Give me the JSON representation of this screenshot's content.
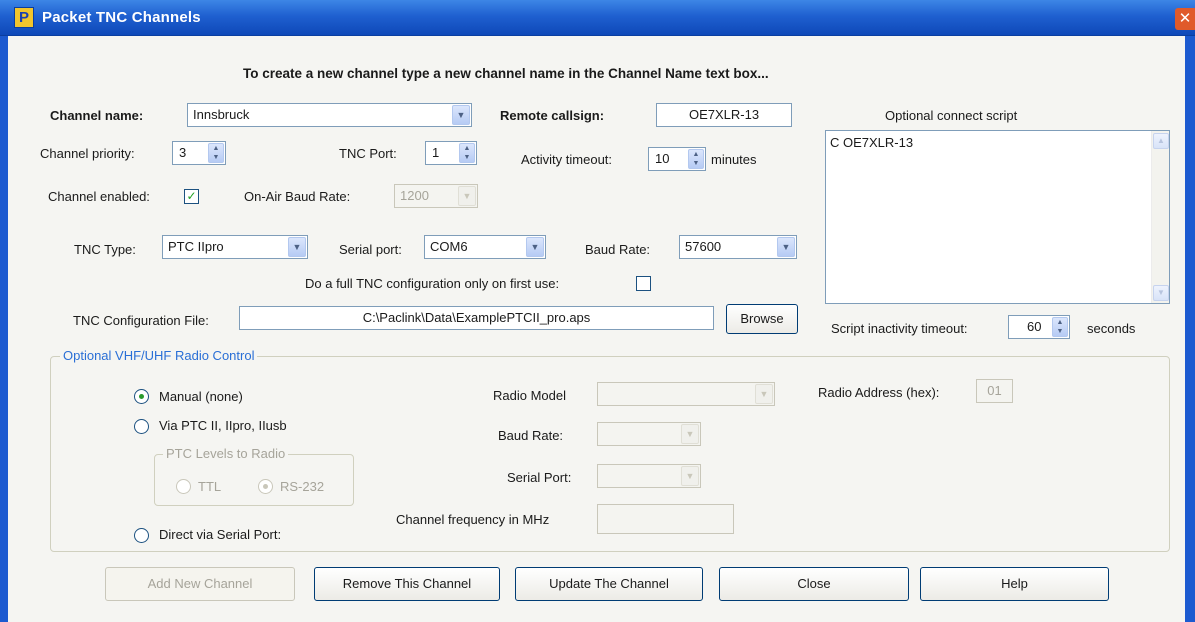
{
  "window": {
    "title": "Packet TNC Channels",
    "app_icon_glyph": "P",
    "close_glyph": "✕"
  },
  "instruction": "To create a new channel type a new channel name in the Channel Name text box...",
  "channel": {
    "name_label": "Channel name:",
    "name_value": "Innsbruck",
    "remote_callsign_label": "Remote callsign:",
    "remote_callsign_value": "OE7XLR-13",
    "priority_label": "Channel priority:",
    "priority_value": "3",
    "tnc_port_label": "TNC Port:",
    "tnc_port_value": "1",
    "activity_timeout_label": "Activity timeout:",
    "activity_timeout_value": "10",
    "activity_timeout_unit": "minutes",
    "enabled_label": "Channel enabled:",
    "enabled_checked": true,
    "onair_baud_label": "On-Air Baud Rate:",
    "onair_baud_value": "1200"
  },
  "tnc": {
    "type_label": "TNC Type:",
    "type_value": "PTC IIpro",
    "serial_port_label": "Serial port:",
    "serial_port_value": "COM6",
    "baud_rate_label": "Baud Rate:",
    "baud_rate_value": "57600",
    "full_config_label": "Do a full TNC configuration only on first use:",
    "full_config_checked": false,
    "config_file_label": "TNC Configuration File:",
    "config_file_value": "C:\\Paclink\\Data\\ExamplePTCII_pro.aps",
    "browse_label": "Browse"
  },
  "script": {
    "label": "Optional connect script",
    "content": "C OE7XLR-13",
    "inactivity_label": "Script inactivity timeout:",
    "inactivity_value": "60",
    "inactivity_unit": "seconds"
  },
  "radio": {
    "group_label": "Optional VHF/UHF Radio Control",
    "manual_label": "Manual (none)",
    "manual_selected": true,
    "via_ptc_label": "Via PTC II, IIpro, IIusb",
    "levels_group_label": "PTC Levels to Radio",
    "ttl_label": "TTL",
    "rs232_label": "RS-232",
    "direct_label": "Direct via Serial Port:",
    "model_label": "Radio Model",
    "model_value": "",
    "address_label": "Radio Address (hex):",
    "address_value": "01",
    "baud_label": "Baud Rate:",
    "baud_value": "",
    "serial_label": "Serial Port:",
    "serial_value": "",
    "frequency_label": "Channel frequency in MHz",
    "frequency_value": ""
  },
  "buttons": {
    "add": "Add New Channel",
    "remove": "Remove This Channel",
    "update": "Update The Channel",
    "close": "Close",
    "help": "Help"
  },
  "icons": {
    "dropdown": "▼",
    "spin_up": "▲",
    "spin_down": "▼",
    "check": "✓"
  },
  "colors": {
    "titlebar": "#1f60d0",
    "client_bg": "#f5f5f2",
    "group_label": "#2a6fd6"
  }
}
